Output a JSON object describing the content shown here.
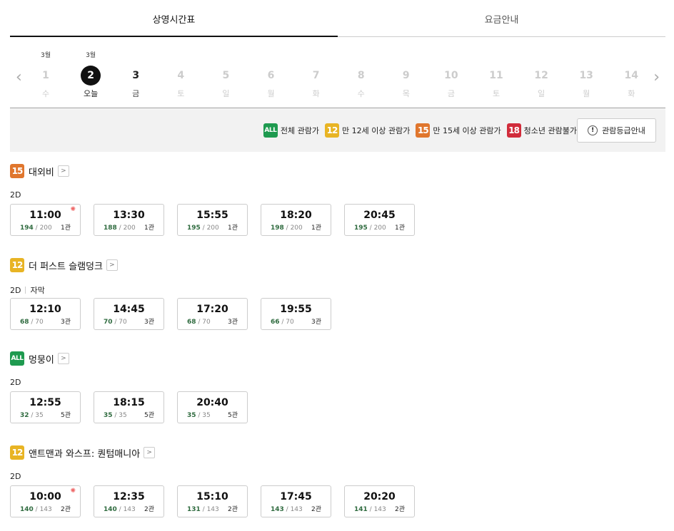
{
  "tabs": [
    "상영시간표",
    "요금안내"
  ],
  "dates": [
    {
      "month": "3월",
      "num": "1",
      "dow": "수",
      "state": "past"
    },
    {
      "month": "3월",
      "num": "2",
      "dow": "오늘",
      "state": "today"
    },
    {
      "month": "",
      "num": "3",
      "dow": "금",
      "state": "avail"
    },
    {
      "month": "",
      "num": "4",
      "dow": "토",
      "state": "off"
    },
    {
      "month": "",
      "num": "5",
      "dow": "일",
      "state": "off"
    },
    {
      "month": "",
      "num": "6",
      "dow": "월",
      "state": "off"
    },
    {
      "month": "",
      "num": "7",
      "dow": "화",
      "state": "off"
    },
    {
      "month": "",
      "num": "8",
      "dow": "수",
      "state": "off"
    },
    {
      "month": "",
      "num": "9",
      "dow": "목",
      "state": "off"
    },
    {
      "month": "",
      "num": "10",
      "dow": "금",
      "state": "off"
    },
    {
      "month": "",
      "num": "11",
      "dow": "토",
      "state": "off"
    },
    {
      "month": "",
      "num": "12",
      "dow": "일",
      "state": "off"
    },
    {
      "month": "",
      "num": "13",
      "dow": "월",
      "state": "off"
    },
    {
      "month": "",
      "num": "14",
      "dow": "화",
      "state": "off"
    }
  ],
  "arrows": {
    "prev": "‹",
    "next": "›"
  },
  "legend": {
    "items": [
      {
        "badge": "ALL",
        "cls": "all",
        "label": "전체 관람가"
      },
      {
        "badge": "12",
        "cls": "r12",
        "label": "만 12세 이상 관람가"
      },
      {
        "badge": "15",
        "cls": "r15",
        "label": "만 15세 이상 관람가"
      },
      {
        "badge": "18",
        "cls": "r18",
        "label": "청소년 관람불가"
      }
    ],
    "guide_button": "관람등급안내",
    "info_glyph": "!"
  },
  "link_glyph": ">",
  "morning_glyph": "✺",
  "movies": [
    {
      "rating": "15",
      "rating_cls": "r15",
      "title": "대외비",
      "format": "2D",
      "subtitle": "",
      "times": [
        {
          "time": "11:00",
          "remain": "194",
          "total": "200",
          "hall": "1관",
          "morning": true
        },
        {
          "time": "13:30",
          "remain": "188",
          "total": "200",
          "hall": "1관",
          "morning": false
        },
        {
          "time": "15:55",
          "remain": "195",
          "total": "200",
          "hall": "1관",
          "morning": false
        },
        {
          "time": "18:20",
          "remain": "198",
          "total": "200",
          "hall": "1관",
          "morning": false
        },
        {
          "time": "20:45",
          "remain": "195",
          "total": "200",
          "hall": "1관",
          "morning": false
        }
      ]
    },
    {
      "rating": "12",
      "rating_cls": "r12",
      "title": "더 퍼스트 슬램덩크",
      "format": "2D",
      "subtitle": "자막",
      "times": [
        {
          "time": "12:10",
          "remain": "68",
          "total": "70",
          "hall": "3관",
          "morning": false
        },
        {
          "time": "14:45",
          "remain": "70",
          "total": "70",
          "hall": "3관",
          "morning": false
        },
        {
          "time": "17:20",
          "remain": "68",
          "total": "70",
          "hall": "3관",
          "morning": false
        },
        {
          "time": "19:55",
          "remain": "66",
          "total": "70",
          "hall": "3관",
          "morning": false
        }
      ]
    },
    {
      "rating": "ALL",
      "rating_cls": "all",
      "title": "멍뭉이",
      "format": "2D",
      "subtitle": "",
      "times": [
        {
          "time": "12:55",
          "remain": "32",
          "total": "35",
          "hall": "5관",
          "morning": false
        },
        {
          "time": "18:15",
          "remain": "35",
          "total": "35",
          "hall": "5관",
          "morning": false
        },
        {
          "time": "20:40",
          "remain": "35",
          "total": "35",
          "hall": "5관",
          "morning": false
        }
      ]
    },
    {
      "rating": "12",
      "rating_cls": "r12",
      "title": "앤트맨과 와스프: 퀀텀매니아",
      "format": "2D",
      "subtitle": "",
      "times": [
        {
          "time": "10:00",
          "remain": "140",
          "total": "143",
          "hall": "2관",
          "morning": true
        },
        {
          "time": "12:35",
          "remain": "140",
          "total": "143",
          "hall": "2관",
          "morning": false
        },
        {
          "time": "15:10",
          "remain": "131",
          "total": "143",
          "hall": "2관",
          "morning": false
        },
        {
          "time": "17:45",
          "remain": "143",
          "total": "143",
          "hall": "2관",
          "morning": false
        },
        {
          "time": "20:20",
          "remain": "141",
          "total": "143",
          "hall": "2관",
          "morning": false
        }
      ]
    }
  ]
}
